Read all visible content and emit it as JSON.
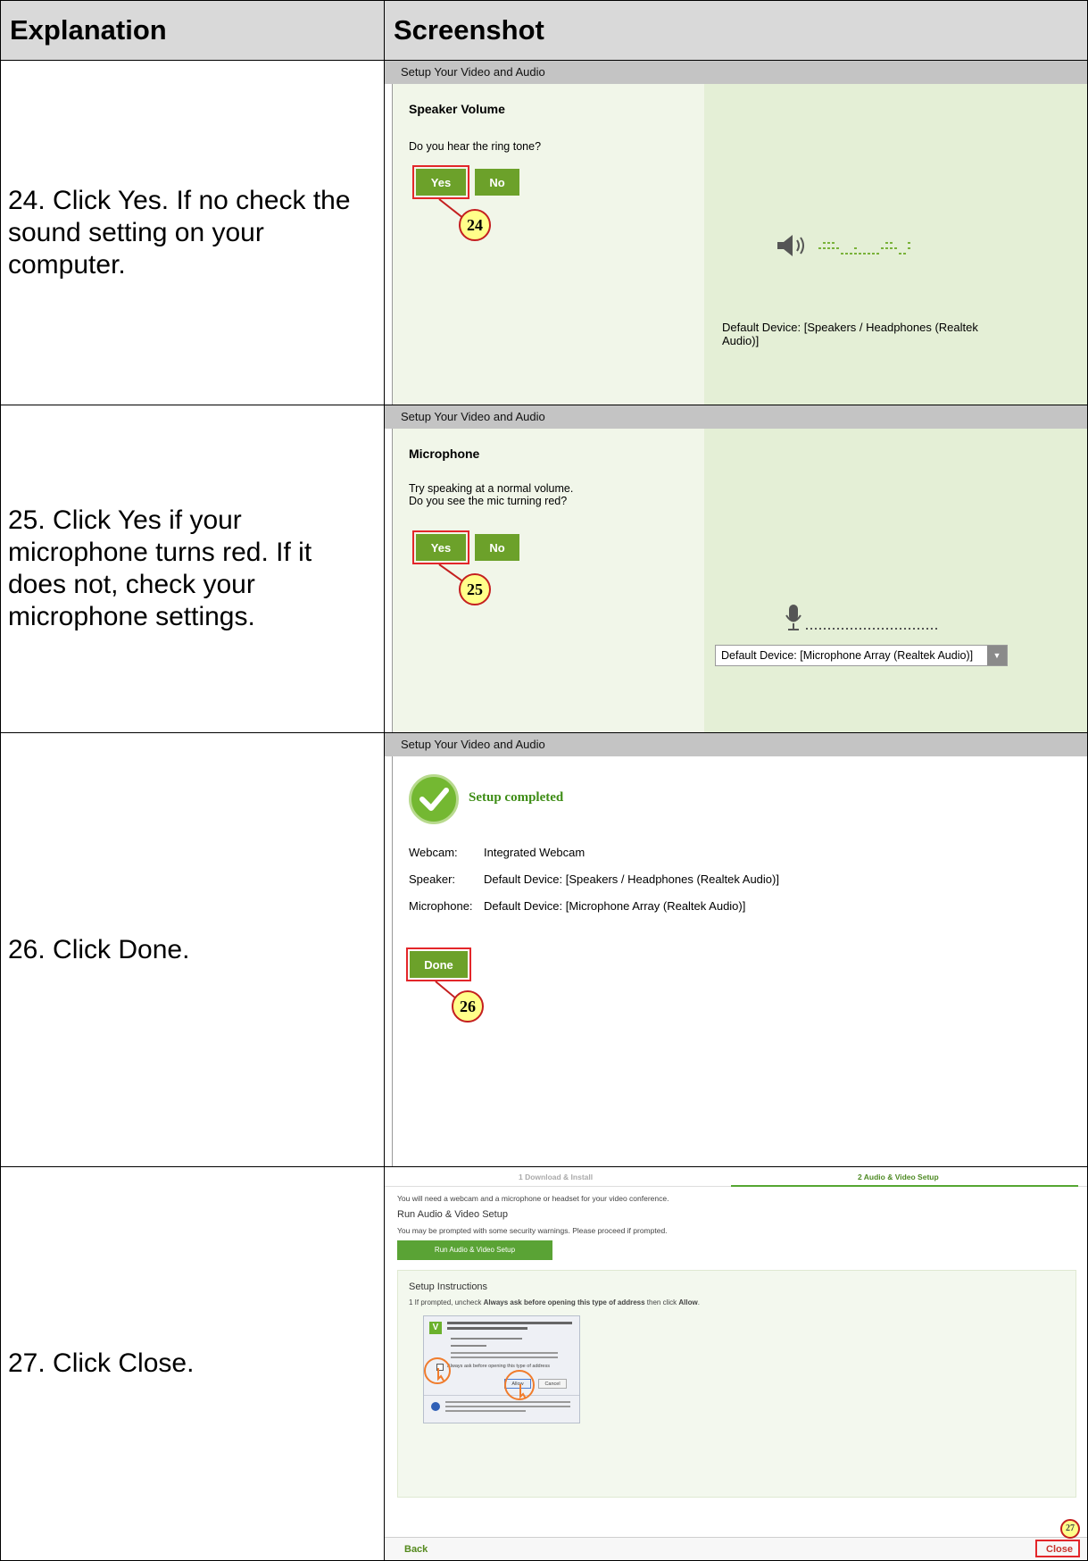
{
  "table": {
    "col_explanation": "Explanation",
    "col_screenshot": "Screenshot"
  },
  "steps": [
    {
      "explanation": "24. Click Yes.  If no check the sound setting on your computer.",
      "screen": {
        "header": "Setup Your Video and Audio",
        "title": "Speaker Volume",
        "question": "Do you hear the ring tone?",
        "yes": "Yes",
        "no": "No",
        "callout": "24",
        "device_text": "Default Device: [Speakers / Headphones (Realtek Audio)]"
      }
    },
    {
      "explanation": "25. Click Yes if your microphone turns red.  If it does not, check your microphone settings.",
      "screen": {
        "header": "Setup Your Video and Audio",
        "title": "Microphone",
        "instruction_1": "Try speaking at a normal volume.",
        "instruction_2": "Do you see the mic turning red?",
        "yes": "Yes",
        "no": "No",
        "callout": "25",
        "device_select": "Default Device: [Microphone Array (Realtek Audio)]"
      }
    },
    {
      "explanation": "26. Click Done.",
      "screen": {
        "header": "Setup Your Video and Audio",
        "status": "Setup completed",
        "devices": [
          {
            "label": "Webcam:",
            "value": "Integrated Webcam"
          },
          {
            "label": "Speaker:",
            "value": "Default Device: [Speakers / Headphones (Realtek Audio)]"
          },
          {
            "label": "Microphone:",
            "value": "Default Device: [Microphone Array (Realtek Audio)]"
          }
        ],
        "done": "Done",
        "callout": "26"
      }
    },
    {
      "explanation": "27. Click Close.",
      "screen": {
        "tab_1": "1 Download & Install",
        "tab_2": "2 Audio & Video Setup",
        "intro": "You will need a webcam and a microphone or headset for your video conference.",
        "section_title": "Run Audio & Video Setup",
        "warning": "You may be prompted with some security warnings. Please proceed if prompted.",
        "run_button": "Run Audio & Video Setup",
        "instructions_title": "Setup Instructions",
        "instruction_pre": "1 If prompted, uncheck ",
        "instruction_bold_1": "Always ask before opening this type of address",
        "instruction_mid": " then click ",
        "instruction_bold_2": "Allow",
        "instruction_end": ".",
        "dialog_checkbox": "Always ask before opening this type of address",
        "dialog_allow": "Allow",
        "dialog_cancel": "Cancel",
        "back": "Back",
        "close": "Close",
        "callout": "27"
      }
    }
  ],
  "colors": {
    "green": "#6ca12a",
    "highlight": "#e3262a",
    "callout_fill": "#ffff8a"
  }
}
